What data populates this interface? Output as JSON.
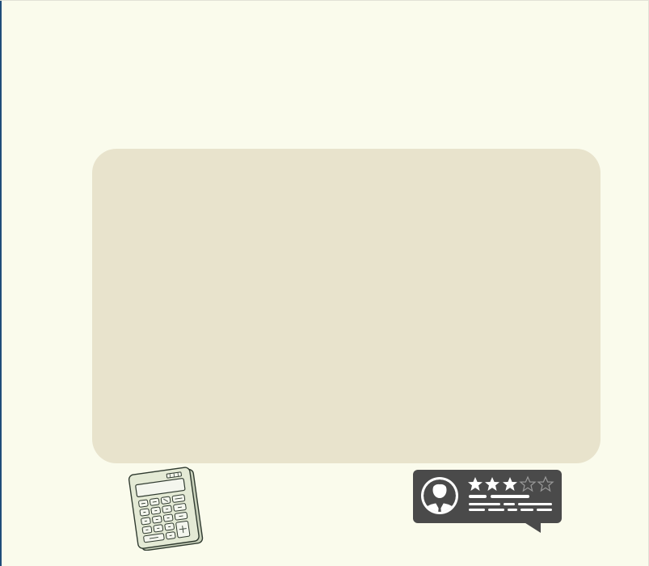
{
  "colors": {
    "page_background": "#fafbec",
    "panel_background": "#e8e3cc",
    "left_edge_accent": "#1f4d7a",
    "calculator_body": "#e4ead5",
    "calculator_outline": "#2f3a2f",
    "review_card_background": "#4a4a4a",
    "review_card_foreground": "#ffffff"
  },
  "illustrations": {
    "calculator": {
      "icon": "calculator-icon",
      "decorative": true
    },
    "review_card": {
      "icon": "customer-review-icon",
      "avatar_icon": "person-avatar-icon",
      "rating": {
        "value": 3,
        "max": 5
      },
      "decorative": true
    }
  }
}
